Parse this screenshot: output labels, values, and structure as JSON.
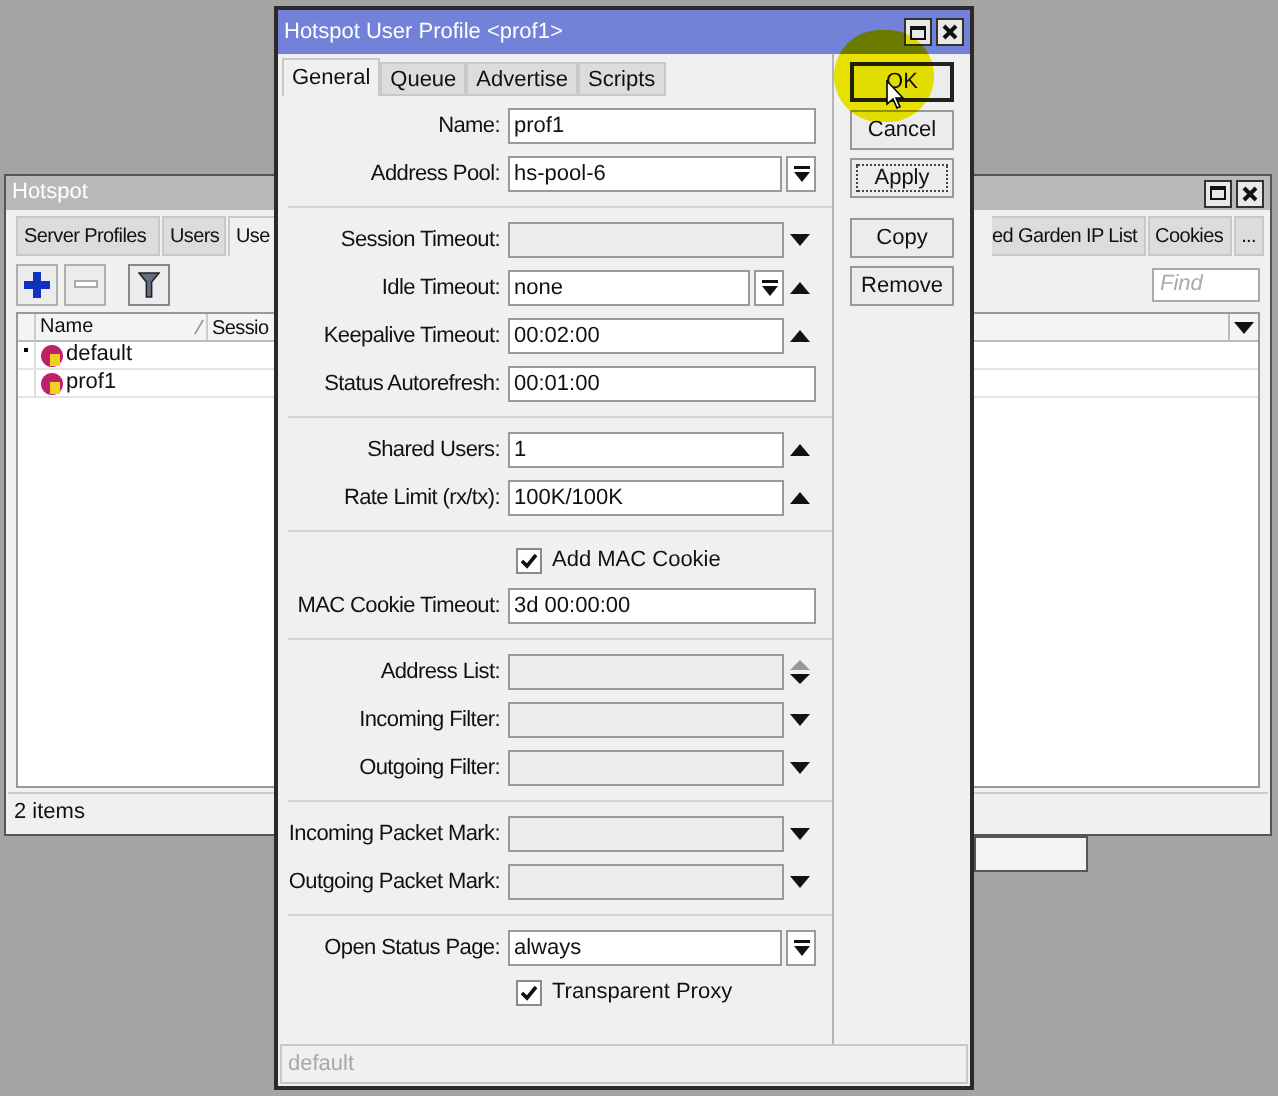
{
  "background_window": {
    "title": "Hotspot",
    "tabs_left": [
      {
        "label": "Server Profiles",
        "selected": false
      },
      {
        "label": "Users",
        "selected": false
      },
      {
        "label": "Use",
        "selected": true
      }
    ],
    "tabs_right": [
      {
        "label": "ed Garden IP List",
        "selected": false
      },
      {
        "label": "Cookies",
        "selected": false
      },
      {
        "label": "...",
        "selected": false
      }
    ],
    "find": {
      "placeholder": "Find"
    },
    "columns": [
      "Name",
      "Sessio"
    ],
    "rows": [
      {
        "default": true,
        "name": "default"
      },
      {
        "default": false,
        "name": "prof1"
      }
    ],
    "status": "2 items"
  },
  "dialog": {
    "title": "Hotspot User Profile <prof1>",
    "tabs": [
      {
        "label": "General",
        "selected": true
      },
      {
        "label": "Queue",
        "selected": false
      },
      {
        "label": "Advertise",
        "selected": false
      },
      {
        "label": "Scripts",
        "selected": false
      }
    ],
    "sections": [
      [
        {
          "kind": "field",
          "label": "Name:",
          "value": "prof1",
          "disabled": false,
          "select_button": false,
          "arrow_up": false,
          "arrow_down": false
        },
        {
          "kind": "field",
          "label": "Address Pool:",
          "value": "hs-pool-6",
          "disabled": false,
          "select_button": true,
          "arrow_up": false,
          "arrow_down": false
        }
      ],
      [
        {
          "kind": "field",
          "label": "Session Timeout:",
          "disabled": true,
          "select_button": false,
          "arrow_up": false,
          "arrow_down": true
        },
        {
          "kind": "field",
          "label": "Idle Timeout:",
          "value": "none",
          "disabled": false,
          "select_button": true,
          "arrow_up": true,
          "arrow_down": false
        },
        {
          "kind": "field",
          "label": "Keepalive Timeout:",
          "value": "00:02:00",
          "disabled": false,
          "select_button": false,
          "arrow_up": true,
          "arrow_down": false
        },
        {
          "kind": "field",
          "label": "Status Autorefresh:",
          "value": "00:01:00",
          "disabled": false,
          "select_button": false,
          "arrow_up": false,
          "arrow_down": false
        }
      ],
      [
        {
          "kind": "field",
          "label": "Shared Users:",
          "value": "1",
          "disabled": false,
          "select_button": false,
          "arrow_up": true,
          "arrow_down": false
        },
        {
          "kind": "field",
          "label": "Rate Limit (rx/tx):",
          "value": "100K/100K",
          "disabled": false,
          "select_button": false,
          "arrow_up": true,
          "arrow_down": false
        }
      ],
      [
        {
          "kind": "checkbox",
          "label": "Add MAC Cookie",
          "checked": true
        },
        {
          "kind": "field",
          "label": "MAC Cookie Timeout:",
          "value": "3d 00:00:00",
          "disabled": false,
          "select_button": false,
          "arrow_up": false,
          "arrow_down": false
        }
      ],
      [
        {
          "kind": "field",
          "label": "Address List:",
          "disabled": true,
          "select_button": false,
          "arrow_up": true,
          "arrow_down": true
        },
        {
          "kind": "field",
          "label": "Incoming Filter:",
          "disabled": true,
          "select_button": false,
          "arrow_up": false,
          "arrow_down": true
        },
        {
          "kind": "field",
          "label": "Outgoing Filter:",
          "disabled": true,
          "select_button": false,
          "arrow_up": false,
          "arrow_down": true
        }
      ],
      [
        {
          "kind": "field",
          "label": "Incoming Packet Mark:",
          "disabled": true,
          "select_button": false,
          "arrow_up": false,
          "arrow_down": true
        },
        {
          "kind": "field",
          "label": "Outgoing Packet Mark:",
          "disabled": true,
          "select_button": false,
          "arrow_up": false,
          "arrow_down": true
        }
      ],
      [
        {
          "kind": "field",
          "label": "Open Status Page:",
          "value": "always",
          "disabled": false,
          "select_button": true,
          "arrow_up": false,
          "arrow_down": false
        },
        {
          "kind": "checkbox",
          "label": "Transparent Proxy",
          "checked": true
        }
      ]
    ],
    "action_buttons": [
      {
        "label": "OK",
        "default": true,
        "focused": false
      },
      {
        "label": "Cancel",
        "default": false,
        "focused": false
      },
      {
        "label": "Apply",
        "default": false,
        "focused": true
      }
    ],
    "item_buttons": [
      {
        "label": "Copy",
        "default": false,
        "focused": false
      },
      {
        "label": "Remove",
        "default": false,
        "focused": false
      }
    ],
    "status": "default"
  }
}
